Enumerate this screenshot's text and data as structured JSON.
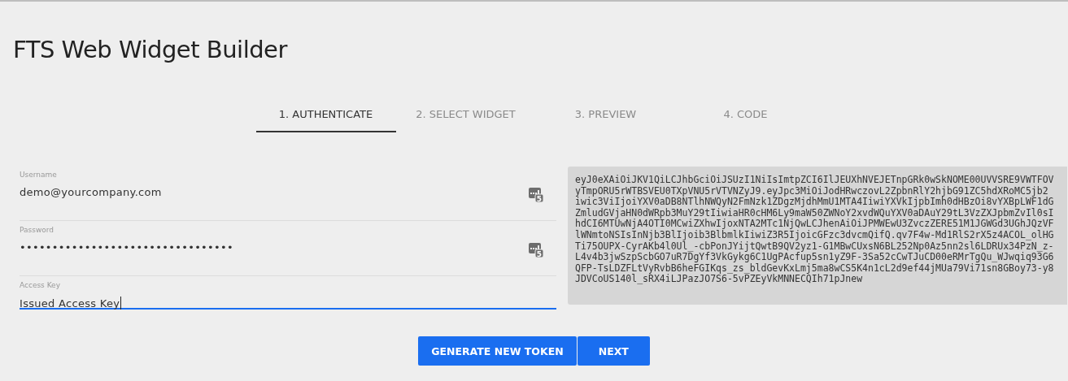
{
  "title": "FTS Web Widget Builder",
  "tabs": [
    {
      "label": "1. AUTHENTICATE",
      "selected": true
    },
    {
      "label": "2. SELECT WIDGET",
      "selected": false
    },
    {
      "label": "3. PREVIEW",
      "selected": false
    },
    {
      "label": "4. CODE",
      "selected": false
    }
  ],
  "fields": [
    {
      "label": "Username",
      "value": "demo@yourcompany.com",
      "focused": false,
      "icon_badge": "5"
    },
    {
      "label": "Password",
      "value": "•••••••••••••••••••••••••••••••••",
      "focused": false,
      "icon_badge": "5"
    },
    {
      "label": "Access Key",
      "value": "Issued Access Key",
      "focused": true
    }
  ],
  "token_lines": [
    "eyJ0eXAiOiJKV1QiLCJhbGciOiJSUzI1NiIsImtpZCI6IlJEUXhNVEJETnpGRk0wSkNOME00UVVSRE9VWTFOV",
    "yTmpORU5rWTBSVEU0TXpVNU5rVTVNZyJ9.eyJpc3MiOiJodHRwczovL2ZpbnRlY2hjbG91ZC5hdXRoMC5jb2",
    "iwic3ViIjoiYXV0aDB8NTlhNWQyN2FmNzk1ZDgzMjdhMmU1MTA4IiwiYXVkIjpbImh0dHBzOi8vYXBpLWF1dG",
    "ZmludGVjaHN0dWRpb3MuY29tIiwiaHR0cHM6Ly9maW50ZWNoY2xvdWQuYXV0aDAuY29tL3VzZXJpbmZvIl0sI",
    "hdCI6MTUwNjA4OTI0MCwiZXhwIjoxNTA2MTc1NjQwLCJhenAiOiJPMWEwU3ZvczZERE51M1JGWGd3UGhJQzVF",
    "lWNmtoNSIsInNjb3BlIjoib3BlbmlkIiwiZ3R5IjoicGFzc3dvcmQifQ.qv7F4w-Md1RlS2rX5z4ACOL_olHG",
    "Ti75OUPX-CyrAKb4l0Ul_-cbPonJYijtQwtB9QV2yz1-G1MBwCUxsN6BL252Np0Az5nn2sl6LDRUx34PzN_z-",
    "L4v4b3jwSzpScbGO7uR7DgYf3VkGykg6C1UgPAcfup5sn1yZ9F-3Sa52cCwTJuCD00eRMrTgQu_WJwqiq93G6",
    "QFP-TsLDZFLtVyRvbB6heFGIKqs_zs_bldGevKxLmj5ma8wCS5K4n1cL2d9ef44jMUa79Vi71sn8GBoy73-y8",
    "JDVCoUS140l_sRX4iLJPazJO7S6-5vPZEyVkMNNECQIh71pJnew"
  ],
  "buttons": [
    "GENERATE NEW TOKEN",
    "NEXT"
  ]
}
